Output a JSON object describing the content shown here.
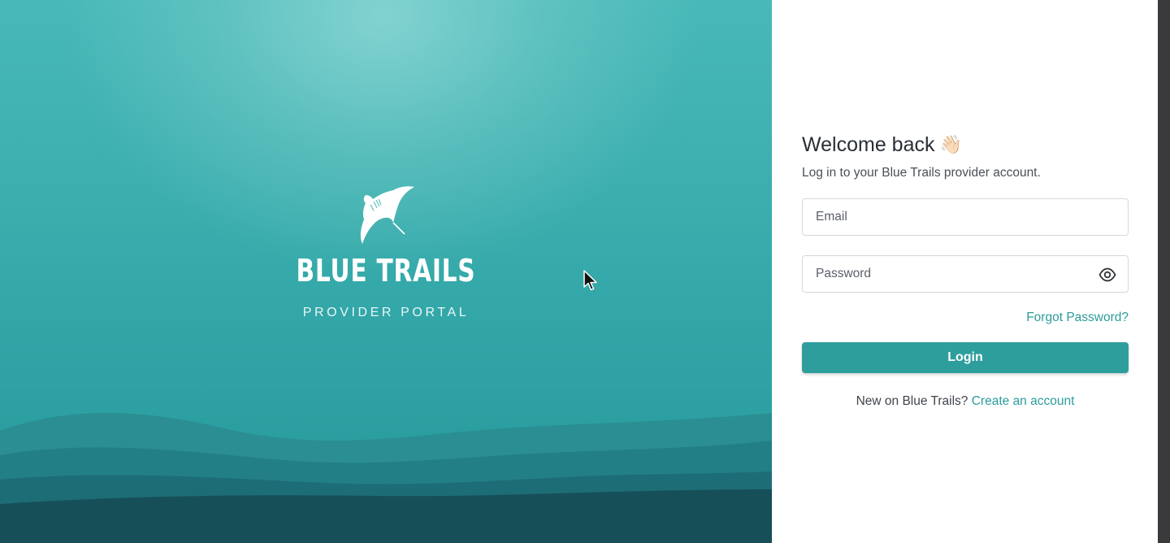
{
  "brand": {
    "name": "BLUE TRAILS",
    "subtitle": "PROVIDER PORTAL"
  },
  "login": {
    "title": "Welcome back",
    "title_emoji": "👋🏻",
    "subtitle": "Log in to your Blue Trails provider account.",
    "email_placeholder": "Email",
    "email_value": "",
    "password_placeholder": "Password",
    "password_value": "",
    "forgot_label": "Forgot Password?",
    "login_label": "Login",
    "signup_prompt": "New on Blue Trails?",
    "signup_link": "Create an account"
  },
  "icons": {
    "logo": "manta-ray-icon",
    "password_toggle": "eye-icon",
    "cursor": "mouse-cursor-icon"
  },
  "colors": {
    "accent": "#2e9e9d",
    "link": "#2c9c9b",
    "hero_top": "#48b9b8",
    "hero_bottom": "#174f58"
  }
}
